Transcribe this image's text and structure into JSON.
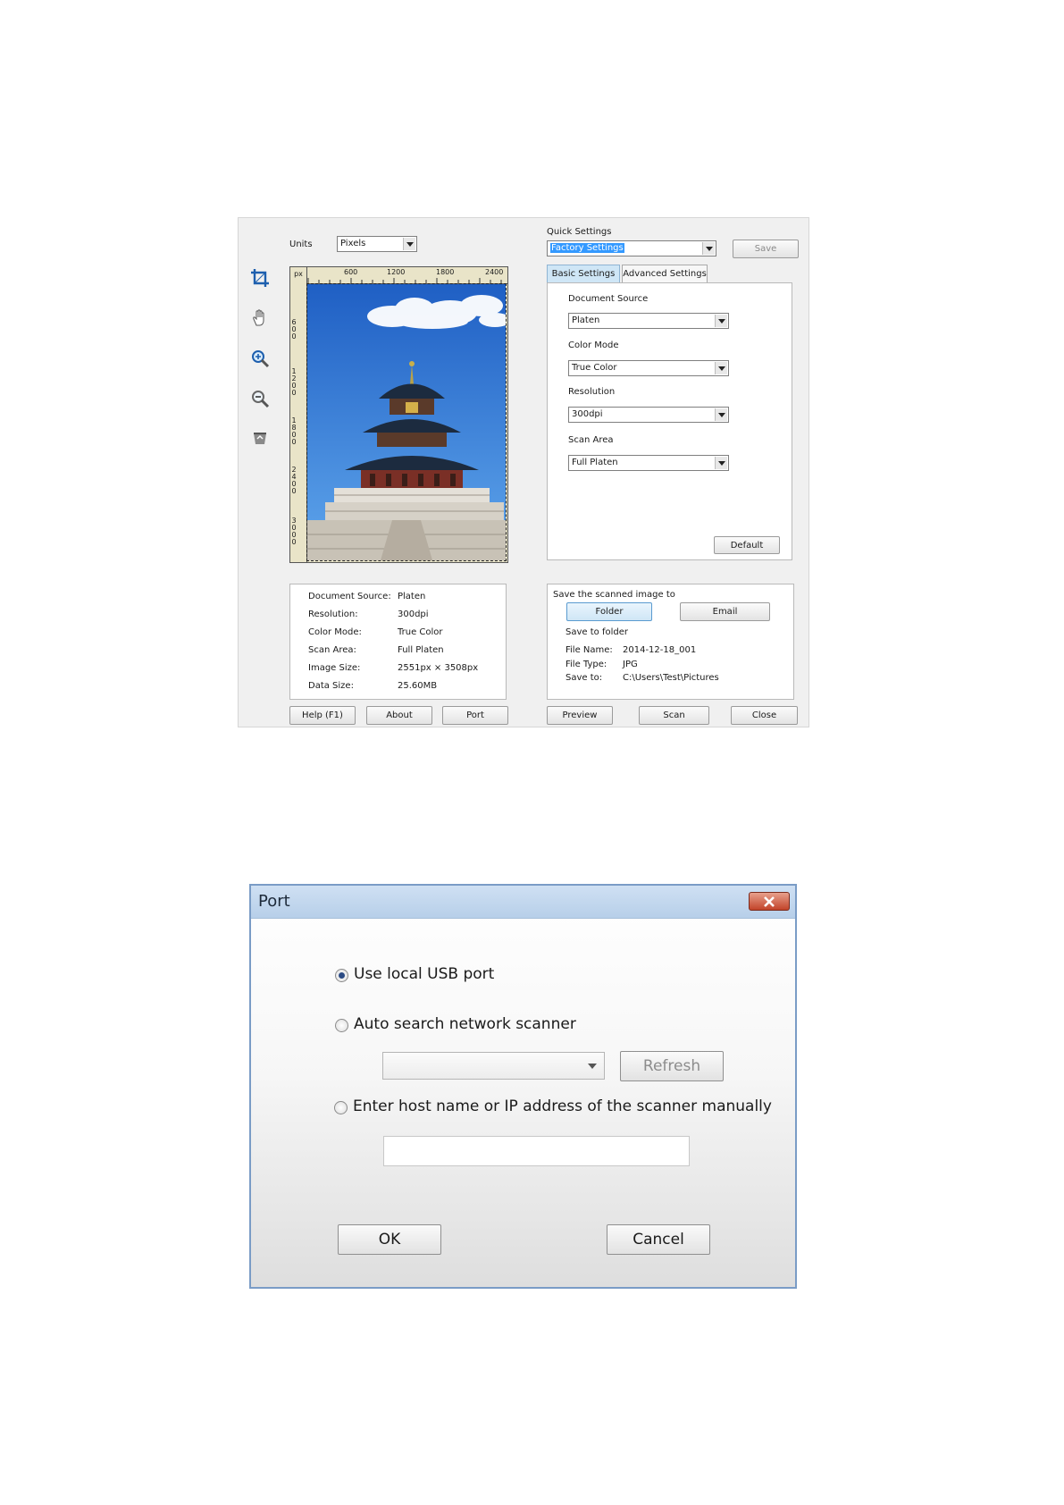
{
  "scanner": {
    "units_label": "Units",
    "units_value": "Pixels",
    "quick_settings_label": "Quick Settings",
    "quick_settings_value": "Factory Settings",
    "save_label": "Save",
    "tabs": [
      "Basic Settings",
      "Advanced Settings"
    ],
    "ruler_unit": "px",
    "ruler_h_ticks": [
      "600",
      "1200",
      "1800",
      "2400"
    ],
    "ruler_v_ticks": [
      "600",
      "1200",
      "1800",
      "2400",
      "3000"
    ],
    "tools": [
      "crop-icon",
      "hand-icon",
      "zoom-in-icon",
      "zoom-out-icon",
      "clear-icon"
    ],
    "basic": {
      "document_source_label": "Document Source",
      "document_source_value": "Platen",
      "color_mode_label": "Color Mode",
      "color_mode_value": "True Color",
      "resolution_label": "Resolution",
      "resolution_value": "300dpi",
      "scan_area_label": "Scan Area",
      "scan_area_value": "Full Platen",
      "default_label": "Default"
    },
    "info": [
      {
        "k": "Document Source:",
        "v": "Platen"
      },
      {
        "k": "Resolution:",
        "v": "300dpi"
      },
      {
        "k": "Color Mode:",
        "v": "True Color"
      },
      {
        "k": "Scan Area:",
        "v": "Full Platen"
      },
      {
        "k": "Image Size:",
        "v": "2551px × 3508px"
      },
      {
        "k": "Data Size:",
        "v": "25.60MB"
      }
    ],
    "save_target": {
      "title": "Save the scanned image to",
      "folder_label": "Folder",
      "email_label": "Email",
      "save_to_folder": "Save to folder",
      "file_name_label": "File Name:",
      "file_name_value": "2014-12-18_001",
      "file_type_label": "File Type:",
      "file_type_value": "JPG",
      "save_to_label": "Save to:",
      "save_to_value": "C:\\Users\\Test\\Pictures"
    },
    "buttons": {
      "help": "Help (F1)",
      "about": "About",
      "port": "Port",
      "preview": "Preview",
      "scan": "Scan",
      "close": "Close"
    }
  },
  "port_dialog": {
    "title": "Port",
    "option_usb": "Use local USB port",
    "option_auto": "Auto search network scanner",
    "option_manual": "Enter host name or IP address of the scanner manually",
    "selected_option": "usb",
    "network_select_value": "",
    "host_input_value": "",
    "refresh_label": "Refresh",
    "ok_label": "OK",
    "cancel_label": "Cancel"
  },
  "colors": {
    "accent_selection": "#3399ff",
    "tab_active": "#cfe6f6",
    "sky": "#2e78d0"
  }
}
